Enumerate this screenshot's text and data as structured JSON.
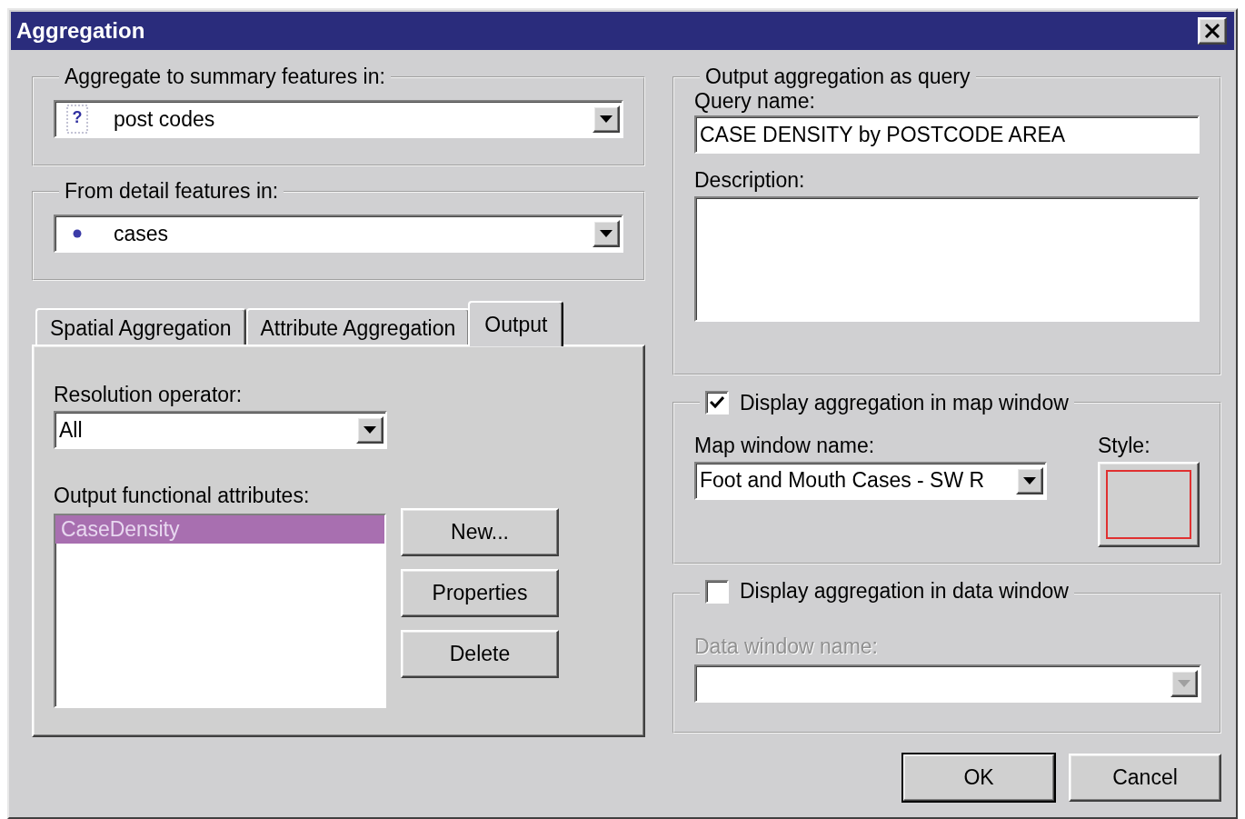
{
  "window": {
    "title": "Aggregation"
  },
  "feature_sources": [
    {
      "legend": "Aggregate to summary features in:",
      "value": "post codes",
      "kind": "unknown",
      "icon": "?"
    },
    {
      "legend": "From detail features in:",
      "value": "cases",
      "kind": "point"
    }
  ],
  "tabs": [
    {
      "label": "Spatial Aggregation",
      "selected": false
    },
    {
      "label": "Attribute Aggregation",
      "selected": false
    },
    {
      "label": "Output",
      "selected": true
    }
  ],
  "output": {
    "resolution_label": "Resolution operator:",
    "resolution_value": "All",
    "attributes_label": "Output functional attributes:",
    "attributes": [
      {
        "label": "CaseDensity",
        "selected": true
      }
    ],
    "buttons": [
      "New...",
      "Properties",
      "Delete"
    ]
  },
  "query": {
    "legend": "Output aggregation as query",
    "name_label": "Query name:",
    "name_value": "CASE DENSITY by POSTCODE AREA",
    "description_label": "Description:"
  },
  "map_display": {
    "label": "Display aggregation in map window",
    "checked": true,
    "name_label": "Map window name:",
    "name_value": "Foot and Mouth Cases - SW R",
    "style_label": "Style:"
  },
  "data_display": {
    "label": "Display aggregation in data window",
    "checked": false,
    "name_label": "Data window name:",
    "disabled": true
  },
  "buttons": [
    {
      "label": "OK",
      "default": true
    },
    {
      "label": "Cancel",
      "default": false
    }
  ]
}
